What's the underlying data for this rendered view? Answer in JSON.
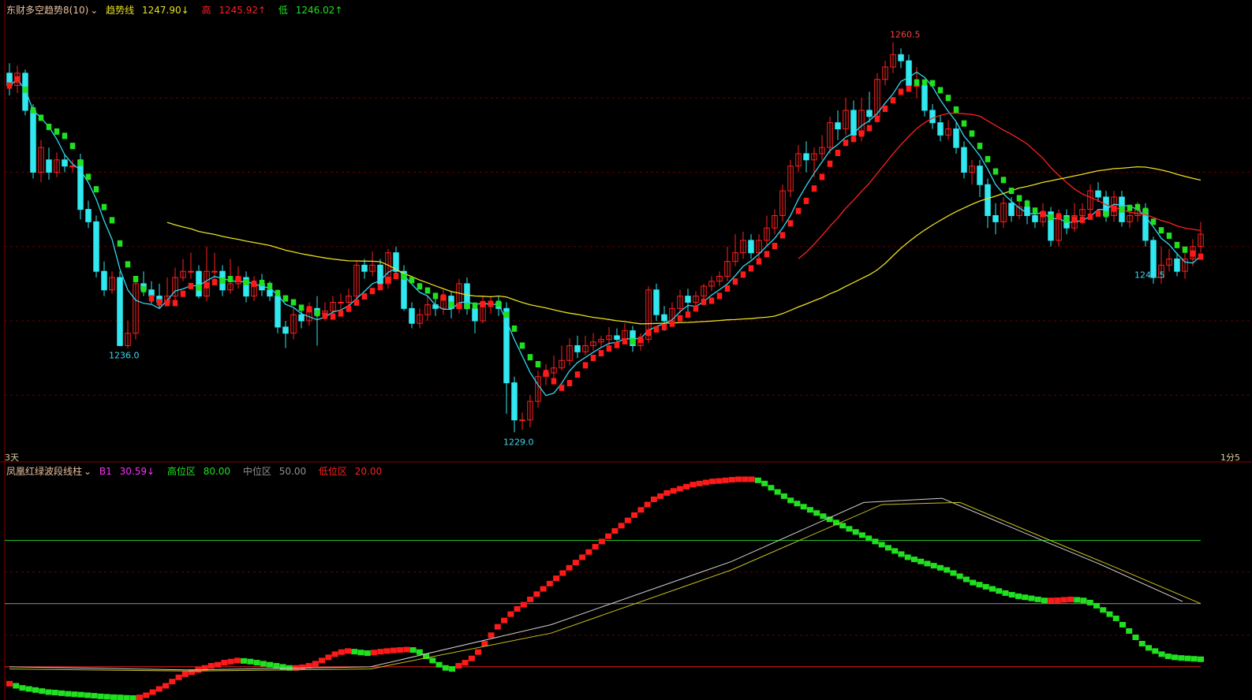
{
  "top_header": {
    "indicator_name": "东财多空趋势8(10)",
    "trend_label": "趋势线",
    "trend_value": "1247.90↓",
    "high_label": "高",
    "high_value": "1245.92↑",
    "low_label": "低",
    "low_value": "1246.02↑"
  },
  "bottom_header": {
    "indicator_name": "凤凰红绿波段线柱",
    "b1_label": "B1",
    "b1_value": "30.59↓",
    "high_zone_label": "高位区",
    "high_zone_value": "80.00",
    "mid_zone_label": "中位区",
    "mid_zone_value": "50.00",
    "low_zone_label": "低位区",
    "low_zone_value": "20.00"
  },
  "corner_left": "3天",
  "corner_right": "1分5",
  "colors": {
    "up": "#ff2020",
    "down": "#30e8f0",
    "signal_green": "#20e020",
    "signal_red": "#ff1a1a",
    "ma_cyan": "#30d8f0",
    "ma_yellow": "#e8e020",
    "ma_red": "#ff2020",
    "grid_red": "#6a0000"
  },
  "chart_data": [
    {
      "type": "candlestick",
      "ylim": [
        1227.5,
        1262.0
      ],
      "candles": [
        [
          1258,
          1257,
          1258.8,
          1256.2
        ],
        [
          1257,
          1258,
          1258.6,
          1256.4
        ],
        [
          1258,
          1255,
          1258.3,
          1254.6
        ],
        [
          1255,
          1250,
          1255.5,
          1249.5
        ],
        [
          1250,
          1252,
          1252.6,
          1249.2
        ],
        [
          1251,
          1250,
          1252.0,
          1249.4
        ],
        [
          1250,
          1251,
          1251.6,
          1249.6
        ],
        [
          1251,
          1250.5,
          1251.4,
          1250.0
        ],
        [
          1250.5,
          1250.5,
          1251.0,
          1250.0
        ],
        [
          1251,
          1247,
          1251.5,
          1246.2
        ],
        [
          1247,
          1246,
          1247.7,
          1245.5
        ],
        [
          1246,
          1242,
          1246.5,
          1241.5
        ],
        [
          1242,
          1240.5,
          1242.8,
          1240.0
        ],
        [
          1240.5,
          1241.5,
          1242.0,
          1240.2
        ],
        [
          1241.5,
          1236.0,
          1242.0,
          1236.0
        ],
        [
          1236,
          1237,
          1238.0,
          1235.8
        ],
        [
          1237,
          1241,
          1241.4,
          1236.5
        ],
        [
          1241,
          1240.5,
          1242.0,
          1240.0
        ],
        [
          1240.5,
          1240,
          1241.2,
          1239.4
        ],
        [
          1240,
          1239.5,
          1241.0,
          1239.0
        ],
        [
          1239.5,
          1240,
          1241.5,
          1239.2
        ],
        [
          1240,
          1241.5,
          1242.3,
          1239.6
        ],
        [
          1241.5,
          1242,
          1243.0,
          1241.2
        ],
        [
          1242,
          1242,
          1243.5,
          1241.4
        ],
        [
          1242,
          1240,
          1242.5,
          1239.8
        ],
        [
          1240,
          1242,
          1244.0,
          1239.6
        ],
        [
          1242,
          1242,
          1243.5,
          1241.2
        ],
        [
          1242,
          1240.5,
          1242.5,
          1240.0
        ],
        [
          1240.5,
          1241,
          1243.0,
          1240.2
        ],
        [
          1241,
          1241.5,
          1242.4,
          1240.6
        ],
        [
          1241.5,
          1240,
          1242.0,
          1239.5
        ],
        [
          1240,
          1241,
          1241.6,
          1239.6
        ],
        [
          1241,
          1240.5,
          1241.8,
          1240.0
        ],
        [
          1240.5,
          1240,
          1241.2,
          1239.6
        ],
        [
          1240,
          1237.5,
          1240.5,
          1237.0
        ],
        [
          1237.5,
          1237,
          1238.0,
          1235.8
        ],
        [
          1237,
          1238.5,
          1239.0,
          1236.5
        ],
        [
          1238.5,
          1238,
          1239.0,
          1237.4
        ],
        [
          1238,
          1239,
          1239.5,
          1237.6
        ],
        [
          1239,
          1238.5,
          1240.0,
          1236.0
        ],
        [
          1238.5,
          1238.8,
          1239.5,
          1238.0
        ],
        [
          1238.8,
          1239.5,
          1240.0,
          1238.4
        ],
        [
          1239.5,
          1239.5,
          1240.2,
          1239.0
        ],
        [
          1239.5,
          1240,
          1240.6,
          1239.0
        ],
        [
          1240,
          1242.5,
          1242.8,
          1239.6
        ],
        [
          1242.5,
          1242,
          1243.0,
          1241.4
        ],
        [
          1242,
          1242.5,
          1243.6,
          1241.6
        ],
        [
          1242.5,
          1241,
          1243.0,
          1240.6
        ],
        [
          1241,
          1243.5,
          1243.8,
          1240.6
        ],
        [
          1243.5,
          1242,
          1244.0,
          1241.5
        ],
        [
          1242,
          1239,
          1242.5,
          1238.8
        ],
        [
          1239,
          1237.8,
          1239.5,
          1237.4
        ],
        [
          1237.8,
          1238.5,
          1239.0,
          1237.4
        ],
        [
          1238.5,
          1239.3,
          1240.0,
          1238.0
        ],
        [
          1239.3,
          1239,
          1239.8,
          1238.4
        ],
        [
          1239,
          1240,
          1240.5,
          1238.5
        ],
        [
          1240,
          1239,
          1240.4,
          1238.2
        ],
        [
          1239,
          1241,
          1241.4,
          1238.6
        ],
        [
          1241,
          1239,
          1241.5,
          1238.5
        ],
        [
          1239,
          1238,
          1239.5,
          1237.0
        ],
        [
          1238,
          1239.5,
          1240.0,
          1237.8
        ],
        [
          1239.5,
          1239.5,
          1240.0,
          1238.6
        ],
        [
          1239.5,
          1239,
          1240.0,
          1238.4
        ],
        [
          1239,
          1233,
          1239.5,
          1230.5
        ],
        [
          1233,
          1230,
          1233.5,
          1229.0
        ],
        [
          1230,
          1230,
          1230.6,
          1229.2
        ],
        [
          1230,
          1231.5,
          1232.0,
          1229.4
        ],
        [
          1231.5,
          1233.5,
          1234.0,
          1231.0
        ],
        [
          1233.5,
          1233.8,
          1234.5,
          1232.8
        ],
        [
          1233.8,
          1234.2,
          1235.2,
          1233.0
        ],
        [
          1234.2,
          1234.8,
          1236.0,
          1234.0
        ],
        [
          1234.8,
          1236.0,
          1236.6,
          1234.4
        ],
        [
          1236,
          1235.5,
          1236.8,
          1235.0
        ],
        [
          1235.5,
          1236.0,
          1236.8,
          1235.2
        ],
        [
          1236,
          1236.3,
          1237.0,
          1235.6
        ],
        [
          1236.3,
          1236.5,
          1236.8,
          1235.8
        ],
        [
          1236.5,
          1236.8,
          1237.5,
          1236.0
        ],
        [
          1236.8,
          1236.5,
          1237.4,
          1236.0
        ],
        [
          1236.5,
          1237.2,
          1237.8,
          1236.2
        ],
        [
          1237.2,
          1236,
          1237.6,
          1235.5
        ],
        [
          1236,
          1236.5,
          1237.0,
          1235.6
        ],
        [
          1236.5,
          1240.5,
          1240.8,
          1236.2
        ],
        [
          1240.5,
          1238.5,
          1241.0,
          1238.0
        ],
        [
          1238.5,
          1238,
          1239.2,
          1237.2
        ],
        [
          1238,
          1239,
          1239.5,
          1237.6
        ],
        [
          1239,
          1240,
          1240.5,
          1238.6
        ],
        [
          1240,
          1239.5,
          1240.6,
          1238.4
        ],
        [
          1239.5,
          1240,
          1240.4,
          1239.0
        ],
        [
          1240,
          1240.8,
          1241.0,
          1239.5
        ],
        [
          1240.8,
          1241.2,
          1241.6,
          1240.4
        ],
        [
          1241.2,
          1241.6,
          1242.0,
          1240.8
        ],
        [
          1241.6,
          1242.8,
          1244.0,
          1241.2
        ],
        [
          1242.8,
          1243.5,
          1245.0,
          1242.4
        ],
        [
          1243.5,
          1244.5,
          1245.2,
          1243.0
        ],
        [
          1244.5,
          1243.5,
          1245.0,
          1243.0
        ],
        [
          1243.5,
          1244.5,
          1245.0,
          1243.0
        ],
        [
          1244.5,
          1245.5,
          1246.5,
          1244.0
        ],
        [
          1245.5,
          1246.5,
          1247.0,
          1245.0
        ],
        [
          1246.5,
          1248.5,
          1249.0,
          1246.0
        ],
        [
          1248.5,
          1250.5,
          1251.0,
          1248.0
        ],
        [
          1250.5,
          1251.5,
          1252.2,
          1250.0
        ],
        [
          1251.5,
          1251,
          1252.5,
          1250.0
        ],
        [
          1251,
          1251.5,
          1252.0,
          1249.6
        ],
        [
          1251.5,
          1252,
          1253.0,
          1251.0
        ],
        [
          1252,
          1254,
          1254.5,
          1251.5
        ],
        [
          1254,
          1253.5,
          1255.0,
          1252.6
        ],
        [
          1253.5,
          1255,
          1256.0,
          1253.0
        ],
        [
          1255,
          1253,
          1255.8,
          1252.8
        ],
        [
          1253,
          1255,
          1256.0,
          1252.5
        ],
        [
          1255,
          1254.5,
          1256.5,
          1254.0
        ],
        [
          1254.5,
          1257.5,
          1258.0,
          1254.0
        ],
        [
          1257.5,
          1258.5,
          1259.0,
          1257.0
        ],
        [
          1258.5,
          1259.5,
          1260.5,
          1258.0
        ],
        [
          1259.5,
          1259,
          1260.0,
          1258.4
        ],
        [
          1259,
          1257,
          1259.5,
          1256.5
        ],
        [
          1257,
          1257,
          1258.5,
          1256.0
        ],
        [
          1257,
          1255,
          1257.4,
          1254.5
        ],
        [
          1255,
          1254,
          1255.5,
          1253.5
        ],
        [
          1254,
          1253,
          1254.6,
          1252.5
        ],
        [
          1253,
          1253.5,
          1254.2,
          1252.6
        ],
        [
          1253.5,
          1252,
          1254.0,
          1251.5
        ],
        [
          1252,
          1250,
          1252.5,
          1249.5
        ],
        [
          1250,
          1250.5,
          1251.0,
          1249.0
        ],
        [
          1250.5,
          1249,
          1251.0,
          1248.0
        ],
        [
          1249,
          1246.5,
          1249.5,
          1245.5
        ],
        [
          1246.5,
          1246,
          1247.5,
          1245.0
        ],
        [
          1246,
          1247.5,
          1248.0,
          1245.5
        ],
        [
          1247.5,
          1246.5,
          1248.0,
          1246.0
        ],
        [
          1246.5,
          1247.2,
          1248.0,
          1246.2
        ],
        [
          1247.2,
          1246.5,
          1247.8,
          1245.8
        ],
        [
          1246.5,
          1246,
          1247.0,
          1245.5
        ],
        [
          1246,
          1246.8,
          1247.5,
          1245.6
        ],
        [
          1246.8,
          1244.5,
          1247.2,
          1244.0
        ],
        [
          1244.5,
          1246.5,
          1247.0,
          1244.0
        ],
        [
          1246.5,
          1245.5,
          1247.0,
          1245.0
        ],
        [
          1245.5,
          1246.5,
          1247.5,
          1245.2
        ],
        [
          1246.5,
          1247,
          1247.5,
          1245.8
        ],
        [
          1247,
          1248.5,
          1249.0,
          1246.6
        ],
        [
          1248.5,
          1248,
          1249.2,
          1247.6
        ],
        [
          1248,
          1246.5,
          1248.5,
          1246.0
        ],
        [
          1246.5,
          1248,
          1248.5,
          1246.0
        ],
        [
          1248,
          1246,
          1248.5,
          1245.6
        ],
        [
          1246,
          1246.5,
          1247.0,
          1245.5
        ],
        [
          1246.5,
          1247,
          1247.6,
          1246.0
        ],
        [
          1247,
          1244.5,
          1247.5,
          1244.0
        ],
        [
          1244.5,
          1241.5,
          1244.8,
          1241.0
        ],
        [
          1241.5,
          1242.5,
          1244.0,
          1241.0
        ],
        [
          1242.5,
          1243,
          1243.8,
          1242.0
        ],
        [
          1243,
          1242,
          1243.5,
          1241.6
        ],
        [
          1242,
          1243,
          1243.6,
          1241.4
        ],
        [
          1243,
          1244,
          1244.6,
          1242.4
        ],
        [
          1244,
          1245,
          1246.0,
          1243.5
        ]
      ],
      "labels": [
        {
          "i": 14,
          "price": 1236.0,
          "text": "1236.0"
        },
        {
          "i": 64,
          "price": 1229.0,
          "text": "1229.0"
        },
        {
          "i": 113,
          "price": 1260.5,
          "text": "1260.5"
        },
        {
          "i": 144,
          "price": 1242.5,
          "text": "1242.5"
        }
      ]
    },
    {
      "type": "bar",
      "ylim": [
        8,
        112
      ],
      "reference_lines": [
        80,
        50,
        20
      ],
      "bars": [
        12,
        11,
        10,
        9.5,
        9,
        8.5,
        8,
        7.8,
        7.5,
        7.2,
        7,
        6.8,
        6.5,
        6.3,
        6,
        5.8,
        5.6,
        5.5,
        5.3,
        5.2,
        5.5,
        6.5,
        8,
        9.5,
        11,
        13,
        15,
        16.5,
        17.5,
        18.5,
        19.5,
        20.5,
        21,
        22,
        22.5,
        23,
        22.8,
        22.5,
        22,
        21.5,
        21,
        20.5,
        20,
        19.5,
        19.5,
        19.8,
        20.5,
        21.5,
        23,
        24.5,
        26,
        27,
        27.5,
        27.2,
        26.8,
        26.5,
        26.8,
        27.2,
        27.5,
        27.8,
        28,
        28.2,
        28,
        27,
        25,
        23,
        21,
        19.5,
        19,
        20.5,
        22,
        24,
        27,
        31,
        35,
        39,
        42,
        45,
        47.5,
        49.5,
        52,
        54.5,
        57,
        59.5,
        62,
        64.5,
        67,
        69.5,
        72,
        74.5,
        77,
        79.5,
        82,
        84.5,
        87,
        89.5,
        92,
        94.5,
        97,
        99.5,
        101,
        102.5,
        103.5,
        104.5,
        105.5,
        106.5,
        107,
        107.5,
        108,
        108.2,
        108.5,
        108.8,
        109,
        109,
        109,
        108.5,
        107,
        105,
        103,
        101,
        99,
        97.5,
        96,
        94.5,
        93,
        91.5,
        90,
        88.5,
        87,
        85.5,
        84,
        82.5,
        81,
        79.5,
        78,
        76.5,
        75,
        73.5,
        72,
        71,
        70,
        69,
        68,
        67,
        66,
        64.5,
        63,
        61.5,
        60,
        59,
        58,
        57,
        56,
        55,
        54.2,
        53.5,
        53,
        52.5,
        52,
        51.5,
        51.5,
        51.6,
        51.8,
        52,
        51.8,
        51.5,
        50.5,
        49,
        47,
        45,
        43,
        40,
        37,
        34,
        31,
        29,
        27.5,
        26,
        25,
        24.5,
        24.2,
        24,
        23.8,
        23.6
      ],
      "series_lines": [
        [
          0,
          20
        ],
        [
          30,
          18.5
        ],
        [
          60,
          20
        ],
        [
          90,
          40
        ],
        [
          120,
          70
        ],
        [
          142,
          98
        ],
        [
          155,
          100
        ],
        [
          170,
          82
        ],
        [
          181,
          69
        ],
        [
          195,
          51
        ]
      ],
      "series_lines2": [
        [
          0,
          19
        ],
        [
          30,
          18
        ],
        [
          60,
          19
        ],
        [
          90,
          36
        ],
        [
          120,
          66
        ],
        [
          145,
          97
        ],
        [
          158,
          98
        ],
        [
          173,
          80
        ],
        [
          184,
          67
        ],
        [
          198,
          50
        ]
      ]
    }
  ]
}
